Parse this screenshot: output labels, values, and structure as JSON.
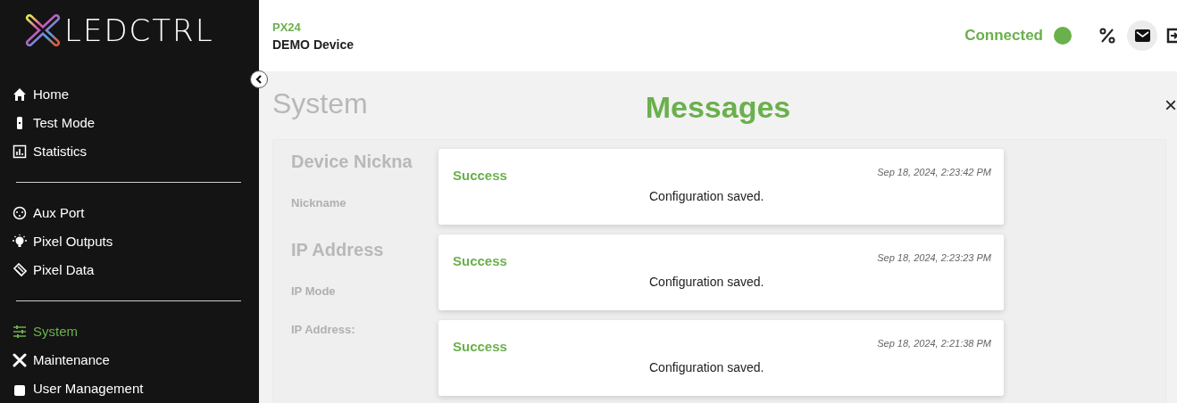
{
  "sidebar": {
    "logo": "LEDCTRL",
    "groups": [
      {
        "items": [
          {
            "label": "Home",
            "selected": false
          },
          {
            "label": "Test Mode",
            "selected": false
          },
          {
            "label": "Statistics",
            "selected": false
          }
        ]
      },
      {
        "items": [
          {
            "label": "Aux Port",
            "selected": false
          },
          {
            "label": "Pixel Outputs",
            "selected": false
          },
          {
            "label": "Pixel Data",
            "selected": false
          }
        ]
      },
      {
        "items": [
          {
            "label": "System",
            "selected": true
          },
          {
            "label": "Maintenance",
            "selected": false
          },
          {
            "label": "User Management",
            "selected": false
          }
        ]
      }
    ]
  },
  "header": {
    "model": "PX24",
    "device": "DEMO Device",
    "status": "Connected",
    "connected": true
  },
  "page": {
    "title": "System",
    "sections": [
      {
        "title": "Device Nickna",
        "fields": [
          "Nickname"
        ]
      },
      {
        "title": "IP Address",
        "fields": [
          "IP Mode",
          "IP Address:"
        ]
      }
    ]
  },
  "messages": {
    "title": "Messages",
    "close": "×",
    "items": [
      {
        "title": "Success",
        "time": "Sep 18, 2024, 2:23:42 PM",
        "text": "Configuration saved."
      },
      {
        "title": "Success",
        "time": "Sep 18, 2024, 2:23:23 PM",
        "text": "Configuration saved."
      },
      {
        "title": "Success",
        "time": "Sep 18, 2024, 2:21:38 PM",
        "text": "Configuration saved."
      }
    ]
  }
}
